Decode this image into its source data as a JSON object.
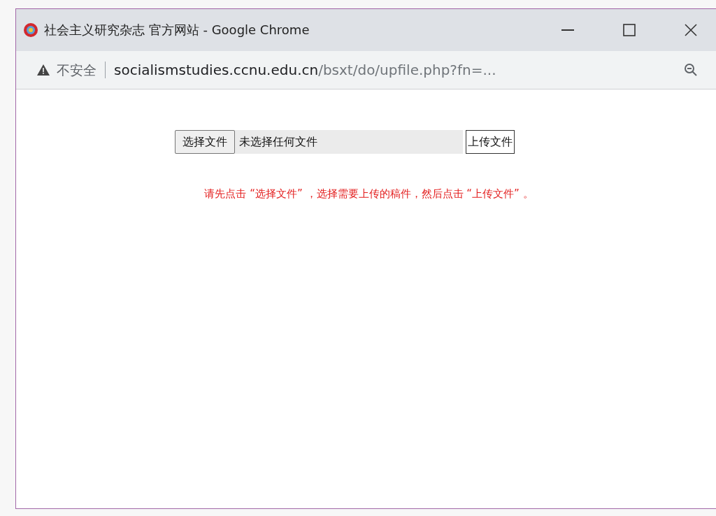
{
  "window": {
    "title": "社会主义研究杂志 官方网站 - Google Chrome"
  },
  "address_bar": {
    "security": "不安全",
    "host": "socialismstudies.ccnu.edu.cn",
    "path": "/bsxt/do/upfile.php?fn=..."
  },
  "upload_form": {
    "choose_button": "选择文件",
    "file_status": "未选择任何文件",
    "upload_button": "上传文件"
  },
  "message": "请先点击 “选择文件” ，选择需要上传的稿件，然后点击  “上传文件” 。"
}
